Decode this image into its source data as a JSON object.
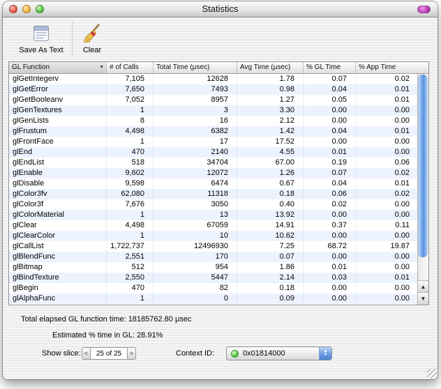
{
  "window": {
    "title": "Statistics"
  },
  "toolbar": {
    "save_as_text_label": "Save As Text",
    "clear_label": "Clear"
  },
  "table": {
    "columns": [
      {
        "label": "GL Function",
        "sorted": "desc"
      },
      {
        "label": "# of Calls"
      },
      {
        "label": "Total Time (μsec)"
      },
      {
        "label": "Avg Time (μsec)"
      },
      {
        "label": "% GL Time"
      },
      {
        "label": "% App Time"
      }
    ],
    "rows": [
      [
        "glGetIntegerv",
        "7,105",
        "12628",
        "1.78",
        "0.07",
        "0.02"
      ],
      [
        "glGetError",
        "7,650",
        "7493",
        "0.98",
        "0.04",
        "0.01"
      ],
      [
        "glGetBooleanv",
        "7,052",
        "8957",
        "1.27",
        "0.05",
        "0.01"
      ],
      [
        "glGenTextures",
        "1",
        "3",
        "3.30",
        "0.00",
        "0.00"
      ],
      [
        "glGenLists",
        "8",
        "16",
        "2.12",
        "0.00",
        "0.00"
      ],
      [
        "glFrustum",
        "4,498",
        "6382",
        "1.42",
        "0.04",
        "0.01"
      ],
      [
        "glFrontFace",
        "1",
        "17",
        "17.52",
        "0.00",
        "0.00"
      ],
      [
        "glEnd",
        "470",
        "2140",
        "4.55",
        "0.01",
        "0.00"
      ],
      [
        "glEndList",
        "518",
        "34704",
        "67.00",
        "0.19",
        "0.06"
      ],
      [
        "glEnable",
        "9,602",
        "12072",
        "1.26",
        "0.07",
        "0.02"
      ],
      [
        "glDisable",
        "9,598",
        "6474",
        "0.67",
        "0.04",
        "0.01"
      ],
      [
        "glColor3fv",
        "62,080",
        "11318",
        "0.18",
        "0.06",
        "0.02"
      ],
      [
        "glColor3f",
        "7,676",
        "3050",
        "0.40",
        "0.02",
        "0.00"
      ],
      [
        "glColorMaterial",
        "1",
        "13",
        "13.92",
        "0.00",
        "0.00"
      ],
      [
        "glClear",
        "4,498",
        "67059",
        "14.91",
        "0.37",
        "0.11"
      ],
      [
        "glClearColor",
        "1",
        "10",
        "10.62",
        "0.00",
        "0.00"
      ],
      [
        "glCallList",
        "1,722,737",
        "12496930",
        "7.25",
        "68.72",
        "19.87"
      ],
      [
        "glBlendFunc",
        "2,551",
        "170",
        "0.07",
        "0.00",
        "0.00"
      ],
      [
        "glBitmap",
        "512",
        "954",
        "1.86",
        "0.01",
        "0.00"
      ],
      [
        "glBindTexture",
        "2,550",
        "5447",
        "2.14",
        "0.03",
        "0.01"
      ],
      [
        "glBegin",
        "470",
        "82",
        "0.18",
        "0.00",
        "0.00"
      ],
      [
        "glAlphaFunc",
        "1",
        "0",
        "0.09",
        "0.00",
        "0.00"
      ]
    ]
  },
  "footer": {
    "total_time_label": "Total elapsed GL function time:",
    "total_time_value": "18185762.80 μsec",
    "gl_percent_label": "Estimated % time in GL:",
    "gl_percent_value": "28.91%",
    "show_slice_label": "Show slice:",
    "slice_value": "25 of 25",
    "context_id_label": "Context ID:",
    "context_id_value": "0x01814000"
  },
  "icons": {
    "sort_desc": "▼",
    "scroll_up": "▲",
    "scroll_down": "▼",
    "popup_up": "▲",
    "popup_down": "▼",
    "slice_prev": "<",
    "slice_next": ">"
  },
  "colors": {
    "row_alt": "#edf3fe",
    "scrollbar_blue": "#5b93e0",
    "led_green": "#52c53f",
    "toolbar_toggle_magenta": "#bb39bb",
    "traffic_red": "#ee5f52",
    "traffic_yellow": "#f4b844",
    "traffic_green": "#5fc948"
  }
}
